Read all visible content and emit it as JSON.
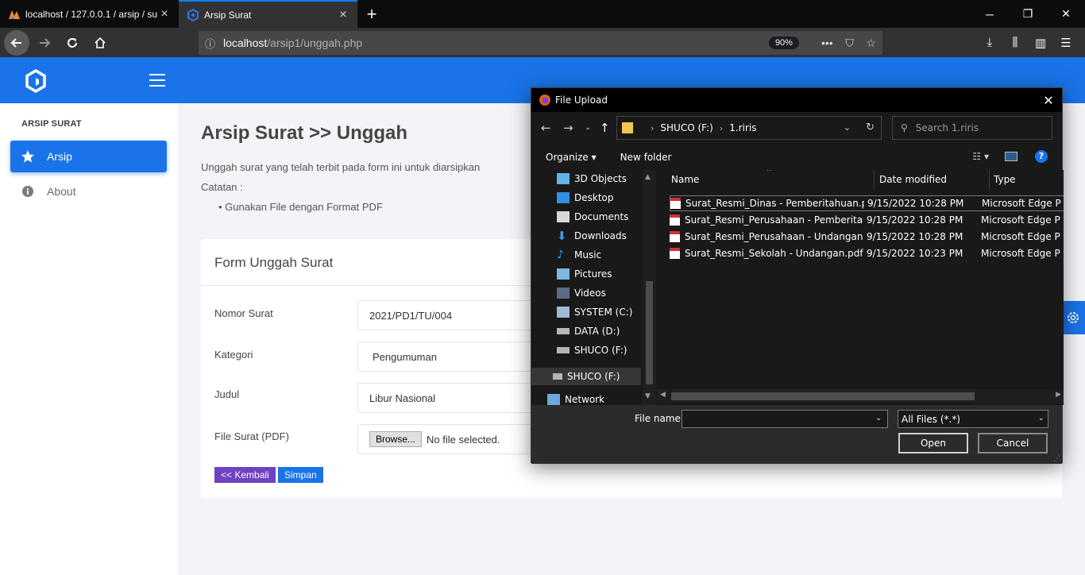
{
  "browser": {
    "tabs": [
      {
        "title": "localhost / 127.0.0.1 / arsip / su",
        "active": false
      },
      {
        "title": "Arsip Surat",
        "active": true
      }
    ],
    "url_host": "localhost",
    "url_path": "/arsip1/unggah.php",
    "zoom": "90%"
  },
  "sidebar": {
    "heading": "ARSIP SURAT",
    "items": [
      {
        "label": "Arsip",
        "icon": "star-icon",
        "active": true
      },
      {
        "label": "About",
        "icon": "info-icon",
        "active": false
      }
    ]
  },
  "main": {
    "title": "Arsip Surat >> Unggah",
    "description": "Unggah surat yang telah terbit pada form ini untuk diarsipkan",
    "note_label": "Catatan :",
    "note_items": [
      "Gunakan File dengan Format PDF"
    ],
    "form": {
      "title": "Form Unggah Surat",
      "fields": [
        {
          "label": "Nomor Surat",
          "value": "2021/PD1/TU/004"
        },
        {
          "label": "Kategori",
          "value": "Pengumuman"
        },
        {
          "label": "Judul",
          "value": "Libur Nasional"
        },
        {
          "label": "File Surat (PDF)",
          "browse_label": "Browse...",
          "status": "No file selected."
        }
      ],
      "back_label": "<< Kembali",
      "save_label": "Simpan"
    }
  },
  "dialog": {
    "title": "File Upload",
    "path": [
      "SHUCO (F:)",
      "1.riris"
    ],
    "search_placeholder": "Search 1.riris",
    "organize_label": "Organize",
    "new_folder_label": "New folder",
    "nav_items": [
      "3D Objects",
      "Desktop",
      "Documents",
      "Downloads",
      "Music",
      "Pictures",
      "Videos",
      "SYSTEM (C:)",
      "DATA (D:)",
      "SHUCO (F:)"
    ],
    "nav_selected": "SHUCO (F:)",
    "nav_partial": "Network",
    "columns": [
      "Name",
      "Date modified",
      "Type"
    ],
    "files": [
      {
        "name": "Surat_Resmi_Dinas - Pemberitahuan.pdf",
        "date": "9/15/2022 10:28 PM",
        "type": "Microsoft Edge P"
      },
      {
        "name": "Surat_Resmi_Perusahaan - Pemberitahua...",
        "date": "9/15/2022 10:28 PM",
        "type": "Microsoft Edge P"
      },
      {
        "name": "Surat_Resmi_Perusahaan - Undangan.pdf",
        "date": "9/15/2022 10:28 PM",
        "type": "Microsoft Edge P"
      },
      {
        "name": "Surat_Resmi_Sekolah - Undangan.pdf",
        "date": "9/15/2022 10:23 PM",
        "type": "Microsoft Edge P"
      }
    ],
    "file_name_label": "File name:",
    "file_name_value": "",
    "filter": "All Files (*.*)",
    "open_label": "Open",
    "cancel_label": "Cancel"
  },
  "colors": {
    "brand": "#1a73e8",
    "back_button": "#6f42c1",
    "dialog_bg": "#191919"
  }
}
